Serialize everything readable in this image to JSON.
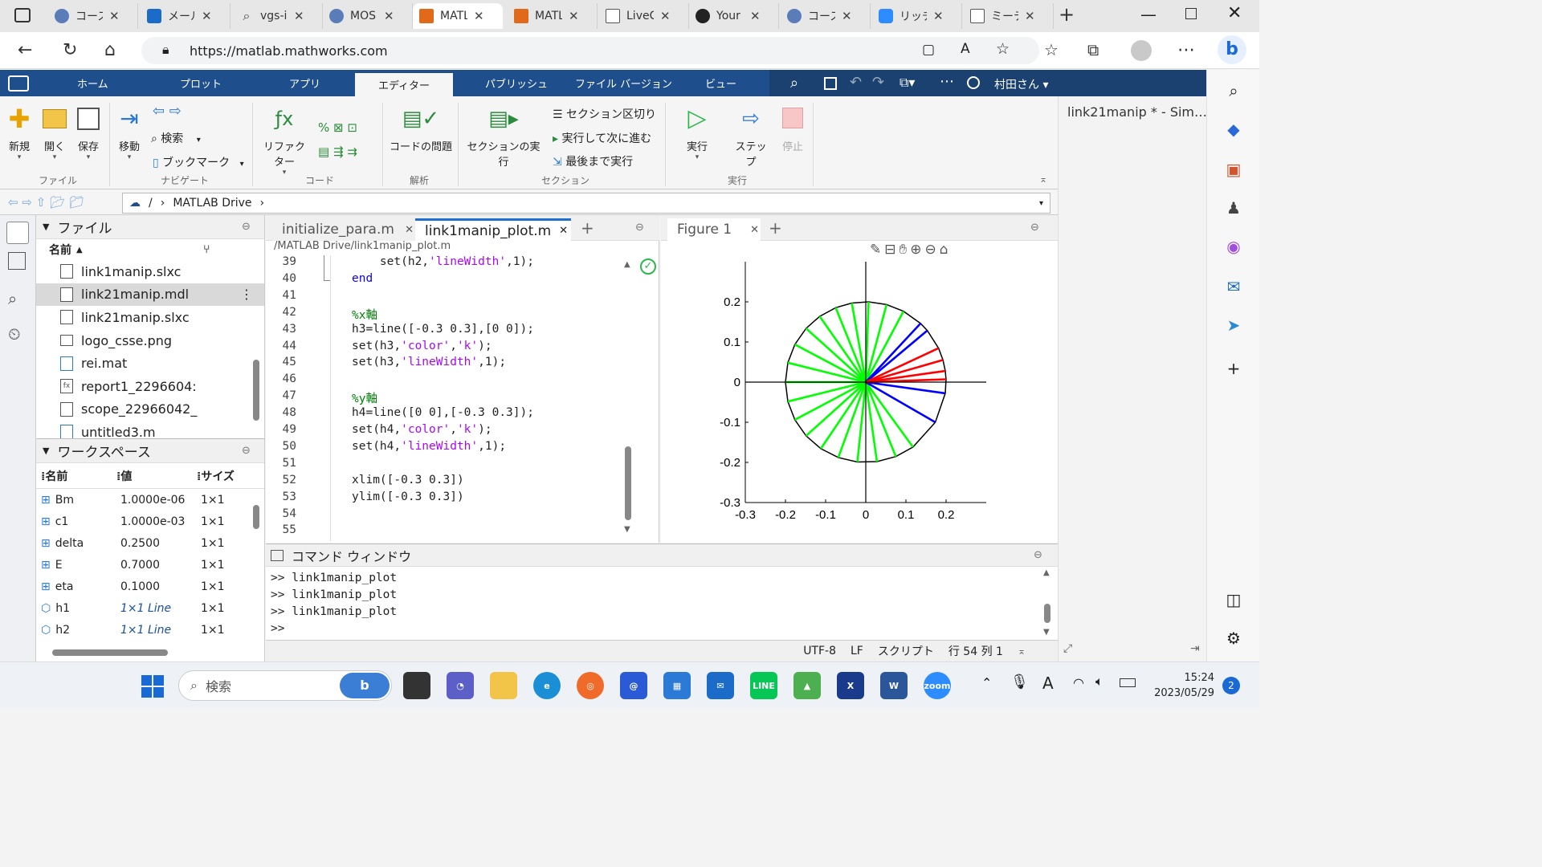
{
  "browser": {
    "tabs": [
      {
        "label": "コース",
        "icon": "edu-icon"
      },
      {
        "label": "メール",
        "icon": "outlook-icon"
      },
      {
        "label": "vgs-i",
        "icon": "search-icon"
      },
      {
        "label": "MOS",
        "icon": "wordpress-icon"
      },
      {
        "label": "MATL",
        "icon": "matlab-icon",
        "active": true
      },
      {
        "label": "MATL",
        "icon": "matlab-icon"
      },
      {
        "label": "LiveC",
        "icon": "doc-icon"
      },
      {
        "label": "Your",
        "icon": "github-icon"
      },
      {
        "label": "コース",
        "icon": "edu-icon"
      },
      {
        "label": "リッチ",
        "icon": "zoom-icon"
      },
      {
        "label": "ミーテ",
        "icon": "doc-icon"
      }
    ],
    "url": "https://matlab.mathworks.com"
  },
  "matlab_tabs": [
    "ホーム",
    "プロット",
    "アプリ",
    "エディター",
    "パブリッシュ",
    "ファイル バージョン",
    "ビュー"
  ],
  "user_name": "村田さん",
  "ribbon": {
    "new": "新規",
    "open": "開く",
    "save": "保存",
    "file_section": "ファイル",
    "move": "移動",
    "search": "検索",
    "bookmark": "ブックマーク",
    "nav_section": "ナビゲート",
    "refactor": "リファクター",
    "code_section": "コード",
    "code_issues": "コードの問題",
    "analysis_section": "解析",
    "run_section_btn": "セクションの実行",
    "section_break": "セクション区切り",
    "run_advance": "実行して次に進む",
    "run_to_end": "最後まで実行",
    "section_section": "セクション",
    "run": "実行",
    "step": "ステップ",
    "stop": "停止",
    "run_group": "実行"
  },
  "path": {
    "root": "/",
    "folder": "MATLAB Drive"
  },
  "file_panel": {
    "title": "ファイル",
    "col_name": "名前",
    "files": [
      {
        "name": "link1manip.slxc",
        "type": "slxc"
      },
      {
        "name": "link21manip.mdl",
        "type": "mdl",
        "selected": true
      },
      {
        "name": "link21manip.slxc",
        "type": "slxc"
      },
      {
        "name": "logo_csse.png",
        "type": "png"
      },
      {
        "name": "rei.mat",
        "type": "mat"
      },
      {
        "name": "report1_2296604:",
        "type": "fx"
      },
      {
        "name": "scope_22966042_",
        "type": "blank"
      },
      {
        "name": "untitled3.m",
        "type": "m"
      }
    ]
  },
  "workspace": {
    "title": "ワークスペース",
    "col_name": "名前",
    "col_value": "値",
    "col_size": "サイズ",
    "rows": [
      {
        "name": "Bm",
        "value": "1.0000e-06",
        "size": "1×1",
        "italic": false
      },
      {
        "name": "c1",
        "value": "1.0000e-03",
        "size": "1×1",
        "italic": false
      },
      {
        "name": "delta",
        "value": "0.2500",
        "size": "1×1",
        "italic": false
      },
      {
        "name": "E",
        "value": "0.7000",
        "size": "1×1",
        "italic": false
      },
      {
        "name": "eta",
        "value": "0.1000",
        "size": "1×1",
        "italic": false
      },
      {
        "name": "h1",
        "value": "1×1 Line",
        "size": "1×1",
        "italic": true
      },
      {
        "name": "h2",
        "value": "1×1 Line",
        "size": "1×1",
        "italic": true
      }
    ]
  },
  "editor": {
    "tabs": [
      "initialize_para.m",
      "link1manip_plot.m"
    ],
    "file_path": "/MATLAB Drive/link1manip_plot.m",
    "lines": [
      {
        "n": "39",
        "parts": [
          [
            "    set(h2,",
            ""
          ],
          [
            "'lineWidth'",
            "str"
          ],
          [
            ",1);",
            ""
          ]
        ]
      },
      {
        "n": "40",
        "parts": [
          [
            "end",
            "kw"
          ]
        ]
      },
      {
        "n": "41",
        "parts": []
      },
      {
        "n": "42",
        "parts": [
          [
            "%x軸",
            "cmt"
          ]
        ]
      },
      {
        "n": "43",
        "parts": [
          [
            "h3=line([-0.3 0.3],[0 0]);",
            ""
          ]
        ]
      },
      {
        "n": "44",
        "parts": [
          [
            "set(h3,",
            ""
          ],
          [
            "'color'",
            "str"
          ],
          [
            ",",
            ""
          ],
          [
            "'k'",
            "str"
          ],
          [
            ");",
            ""
          ]
        ]
      },
      {
        "n": "45",
        "parts": [
          [
            "set(h3,",
            ""
          ],
          [
            "'lineWidth'",
            "str"
          ],
          [
            ",1);",
            ""
          ]
        ]
      },
      {
        "n": "46",
        "parts": []
      },
      {
        "n": "47",
        "parts": [
          [
            "%y軸",
            "cmt"
          ]
        ]
      },
      {
        "n": "48",
        "parts": [
          [
            "h4=line([0 0],[-0.3 0.3]);",
            ""
          ]
        ]
      },
      {
        "n": "49",
        "parts": [
          [
            "set(h4,",
            ""
          ],
          [
            "'color'",
            "str"
          ],
          [
            ",",
            ""
          ],
          [
            "'k'",
            "str"
          ],
          [
            ");",
            ""
          ]
        ]
      },
      {
        "n": "50",
        "parts": [
          [
            "set(h4,",
            ""
          ],
          [
            "'lineWidth'",
            "str"
          ],
          [
            ",1);",
            ""
          ]
        ]
      },
      {
        "n": "51",
        "parts": []
      },
      {
        "n": "52",
        "parts": [
          [
            "xlim([-0.3 0.3])",
            ""
          ]
        ]
      },
      {
        "n": "53",
        "parts": [
          [
            "ylim([-0.3 0.3])",
            ""
          ]
        ]
      },
      {
        "n": "54",
        "parts": []
      },
      {
        "n": "55",
        "parts": []
      }
    ]
  },
  "figure": {
    "tab": "Figure 1"
  },
  "chart_data": {
    "type": "line",
    "xlim": [
      -0.3,
      0.3
    ],
    "ylim": [
      -0.3,
      0.3
    ],
    "xticks": [
      "-0.3",
      "-0.2",
      "-0.1",
      "0",
      "0.1",
      "0.2"
    ],
    "yticks": [
      "0.2",
      "0.1",
      "0",
      "-0.1",
      "-0.2",
      "-0.3"
    ],
    "radius": 0.2,
    "green_angles_deg": [
      100,
      112,
      125,
      138,
      152,
      166,
      180,
      194,
      208,
      222,
      236,
      250,
      264,
      278,
      292,
      306,
      75,
      88,
      62
    ],
    "blue_angles_deg": [
      47,
      40,
      -8,
      -30
    ],
    "red_angles_deg": [
      25,
      16,
      8,
      2
    ],
    "colors": {
      "green": "#00ff00",
      "blue": "#0000ff",
      "red": "#ff0000",
      "axis": "#000000"
    }
  },
  "command_window": {
    "title": "コマンド ウィンドウ",
    "lines": [
      ">> link1manip_plot",
      ">> link1manip_plot",
      ">> link1manip_plot"
    ],
    "prompt": ">>"
  },
  "status": {
    "encoding": "UTF-8",
    "eol": "LF",
    "type": "スクリプト",
    "pos": "行 54 列 1"
  },
  "side_panel": {
    "title": "link21manip * - Sim…"
  },
  "taskbar": {
    "search_placeholder": "検索",
    "time": "15:24",
    "date": "2023/05/29",
    "badge": "2"
  }
}
